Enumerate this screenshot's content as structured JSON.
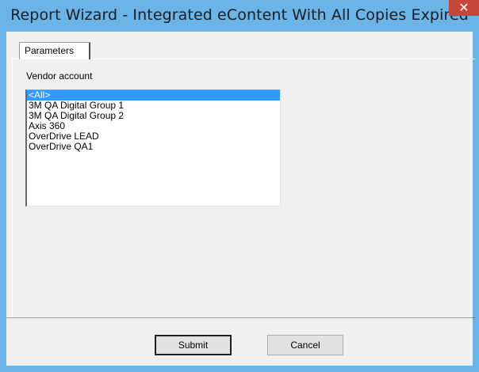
{
  "window": {
    "title": "Report Wizard - Integrated eContent With All Copies Expired",
    "close_glyph": "✕"
  },
  "tabs": [
    {
      "label": "Parameters",
      "active": true
    }
  ],
  "parameters": {
    "vendor_label": "Vendor account",
    "vendor_options": [
      "<All>",
      "3M QA Digital Group 1",
      "3M QA Digital Group 2",
      "Axis 360",
      "OverDrive LEAD",
      "OverDrive QA1"
    ],
    "selected_option": "<All>"
  },
  "buttons": {
    "submit_label": "Submit",
    "cancel_label": "Cancel"
  },
  "colors": {
    "titlebar": "#6bb4e8",
    "close": "#c7463a",
    "selection": "#3399ff"
  }
}
